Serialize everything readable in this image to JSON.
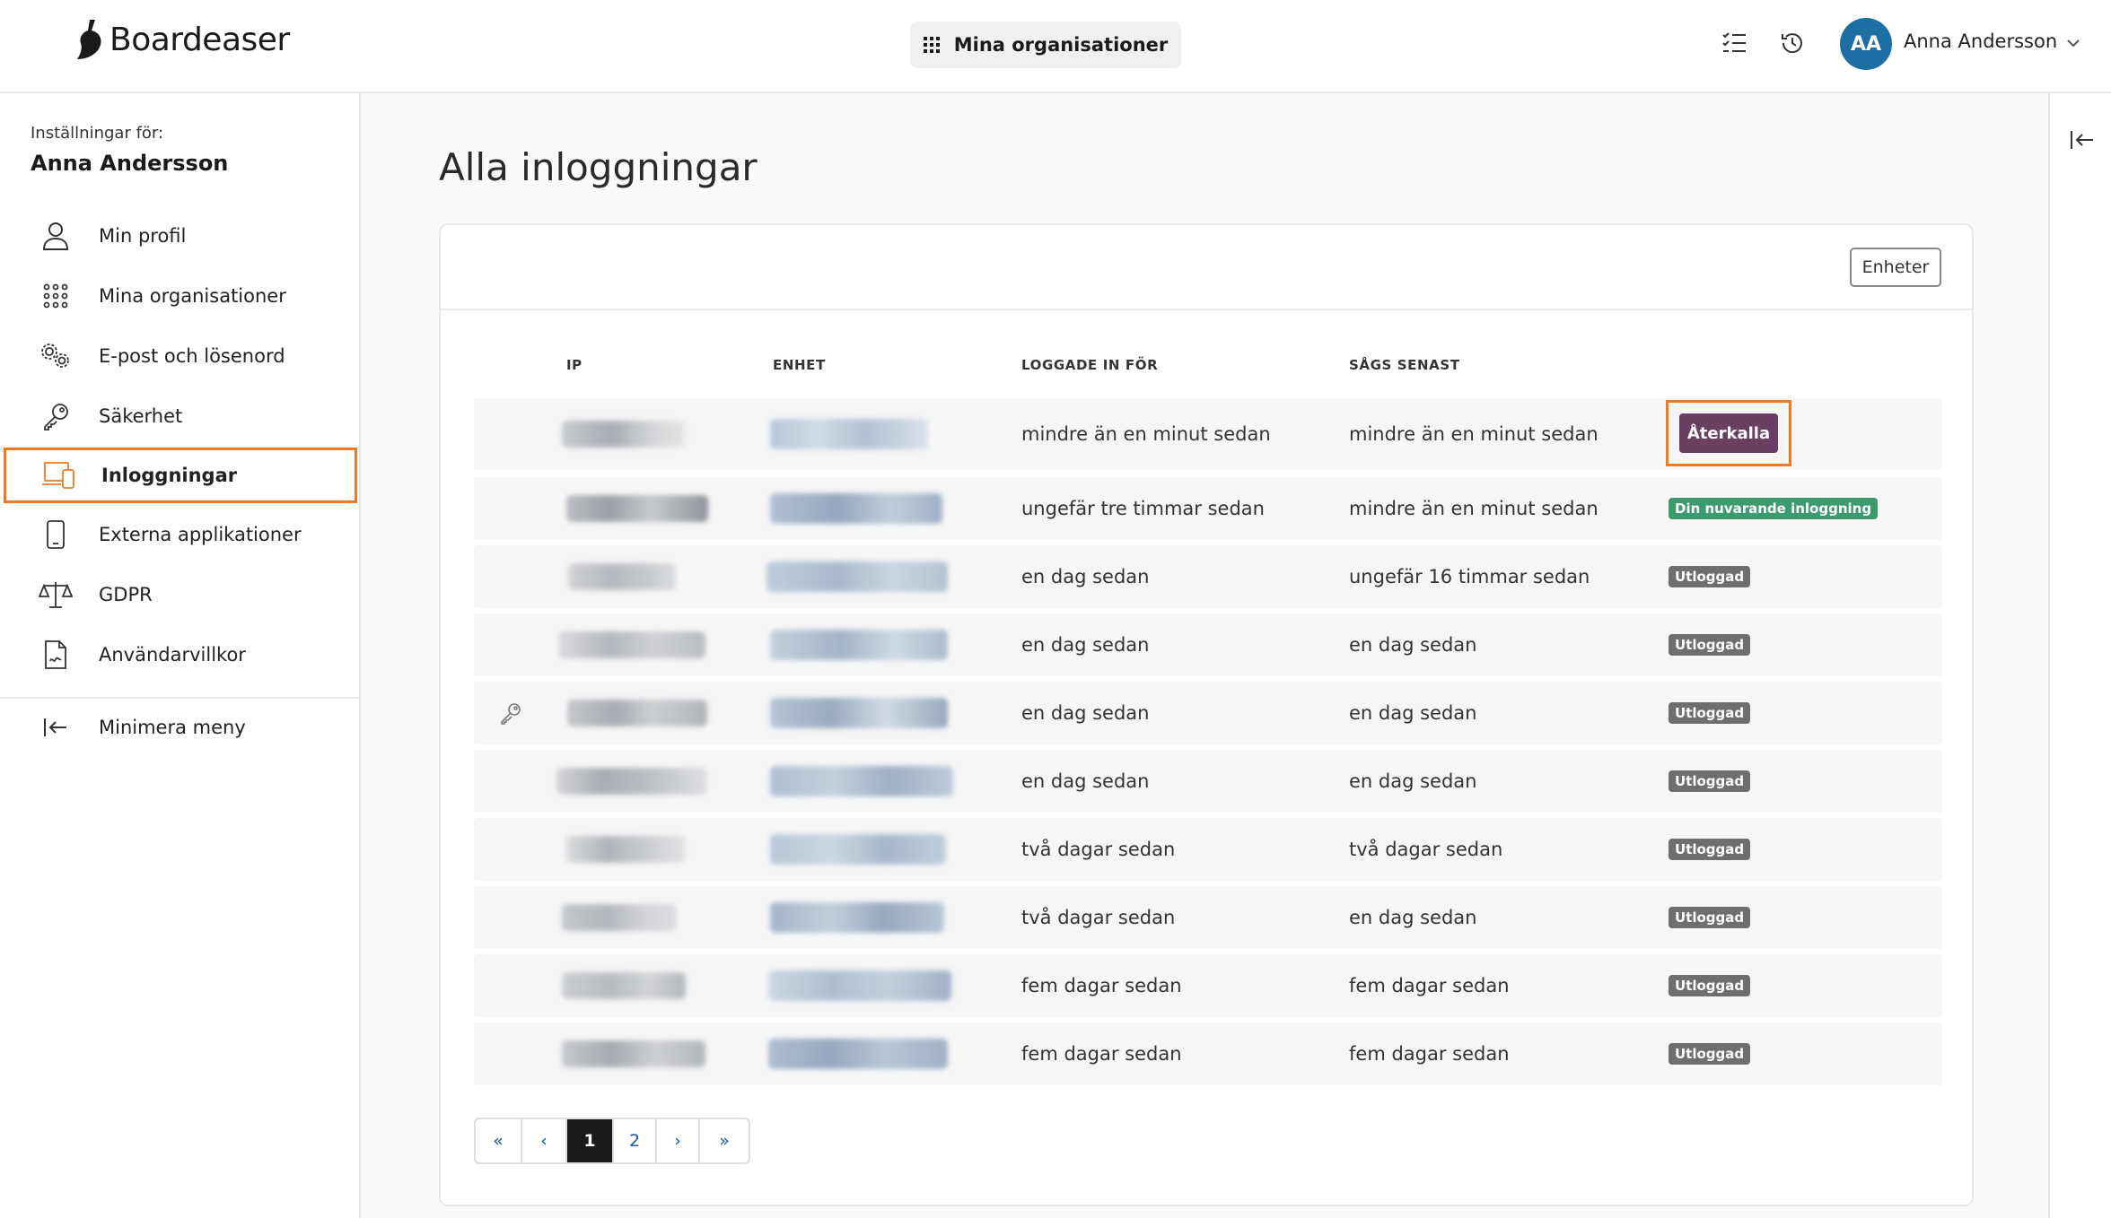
{
  "app": {
    "brand": "Boardeaser",
    "orgs_button": "Mina organisationer",
    "user_initials": "AA",
    "user_name": "Anna Andersson"
  },
  "sidebar": {
    "settings_for": "Inställningar för:",
    "user_name": "Anna Andersson",
    "items": [
      {
        "label": "Min profil",
        "icon": "user-icon"
      },
      {
        "label": "Mina organisationer",
        "icon": "grid-icon"
      },
      {
        "label": "E-post och lösenord",
        "icon": "gears-icon"
      },
      {
        "label": "Säkerhet",
        "icon": "key-icon"
      },
      {
        "label": "Inloggningar",
        "icon": "devices-icon",
        "active": true
      },
      {
        "label": "Externa applikationer",
        "icon": "phone-icon"
      },
      {
        "label": "GDPR",
        "icon": "scale-icon"
      },
      {
        "label": "Användarvillkor",
        "icon": "document-icon"
      }
    ],
    "minimize": "Minimera meny"
  },
  "main": {
    "title": "Alla inloggningar",
    "units_button": "Enheter",
    "columns": {
      "ip": "IP",
      "device": "ENHET",
      "logged_in": "LOGGADE IN FÖR",
      "last_seen": "SÅGS SENAST"
    },
    "rows": [
      {
        "logged_in": "mindre än en minut sedan",
        "last_seen": "mindre än en minut sedan",
        "action": "Återkalla"
      },
      {
        "logged_in": "ungefär tre timmar sedan",
        "last_seen": "mindre än en minut sedan",
        "status": "Din nuvarande inloggning"
      },
      {
        "logged_in": "en dag sedan",
        "last_seen": "ungefär 16 timmar sedan",
        "status": "Utloggad"
      },
      {
        "logged_in": "en dag sedan",
        "last_seen": "en dag sedan",
        "status": "Utloggad"
      },
      {
        "logged_in": "en dag sedan",
        "last_seen": "en dag sedan",
        "status": "Utloggad"
      },
      {
        "logged_in": "en dag sedan",
        "last_seen": "en dag sedan",
        "status": "Utloggad"
      },
      {
        "logged_in": "två dagar sedan",
        "last_seen": "två dagar sedan",
        "status": "Utloggad"
      },
      {
        "logged_in": "två dagar sedan",
        "last_seen": "en dag sedan",
        "status": "Utloggad"
      },
      {
        "logged_in": "fem dagar sedan",
        "last_seen": "fem dagar sedan",
        "status": "Utloggad"
      },
      {
        "logged_in": "fem dagar sedan",
        "last_seen": "fem dagar sedan",
        "status": "Utloggad"
      }
    ],
    "pagination": {
      "first": "«",
      "prev": "‹",
      "pages": [
        "1",
        "2"
      ],
      "current": "1",
      "next": "›",
      "last": "»"
    }
  },
  "colors": {
    "accent_outline": "#f07a21",
    "revoke_button": "#6b3f62",
    "current_badge": "#3d9a6e",
    "logged_out_badge": "#6e6e6e",
    "avatar": "#1d6fa3"
  }
}
